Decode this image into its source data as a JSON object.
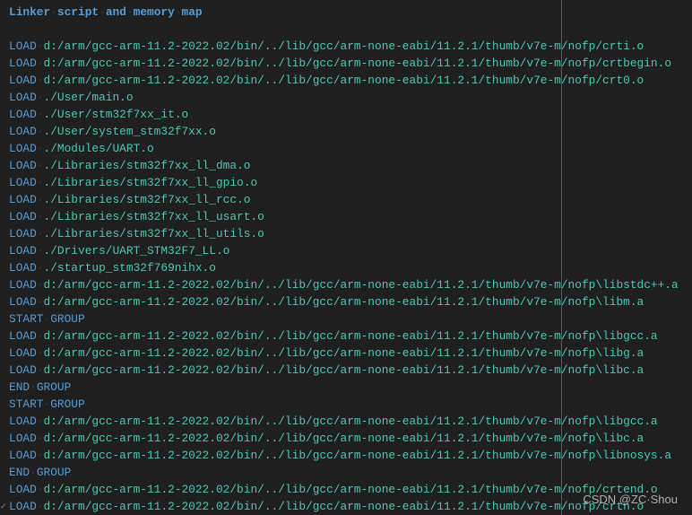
{
  "editor": {
    "whitespace_glyph": "·",
    "colors": {
      "background": "#1f1f1f",
      "keyword": "#569cd6",
      "path": "#4ec9b0",
      "whitespace": "#3e3e3e",
      "ruler": "#5a5a5a"
    },
    "lines": [
      {
        "type": "title",
        "words": [
          "Linker",
          "script",
          "and",
          "memory",
          "map"
        ]
      },
      {
        "type": "blank"
      },
      {
        "type": "cmd",
        "keyword": [
          "LOAD"
        ],
        "path": "d:/arm/gcc-arm-11.2-2022.02/bin/../lib/gcc/arm-none-eabi/11.2.1/thumb/v7e-m/nofp/crti.o"
      },
      {
        "type": "cmd",
        "keyword": [
          "LOAD"
        ],
        "path": "d:/arm/gcc-arm-11.2-2022.02/bin/../lib/gcc/arm-none-eabi/11.2.1/thumb/v7e-m/nofp/crtbegin.o"
      },
      {
        "type": "cmd",
        "keyword": [
          "LOAD"
        ],
        "path": "d:/arm/gcc-arm-11.2-2022.02/bin/../lib/gcc/arm-none-eabi/11.2.1/thumb/v7e-m/nofp/crt0.o"
      },
      {
        "type": "cmd",
        "keyword": [
          "LOAD"
        ],
        "path": "./User/main.o"
      },
      {
        "type": "cmd",
        "keyword": [
          "LOAD"
        ],
        "path": "./User/stm32f7xx_it.o"
      },
      {
        "type": "cmd",
        "keyword": [
          "LOAD"
        ],
        "path": "./User/system_stm32f7xx.o"
      },
      {
        "type": "cmd",
        "keyword": [
          "LOAD"
        ],
        "path": "./Modules/UART.o"
      },
      {
        "type": "cmd",
        "keyword": [
          "LOAD"
        ],
        "path": "./Libraries/stm32f7xx_ll_dma.o"
      },
      {
        "type": "cmd",
        "keyword": [
          "LOAD"
        ],
        "path": "./Libraries/stm32f7xx_ll_gpio.o"
      },
      {
        "type": "cmd",
        "keyword": [
          "LOAD"
        ],
        "path": "./Libraries/stm32f7xx_ll_rcc.o"
      },
      {
        "type": "cmd",
        "keyword": [
          "LOAD"
        ],
        "path": "./Libraries/stm32f7xx_ll_usart.o"
      },
      {
        "type": "cmd",
        "keyword": [
          "LOAD"
        ],
        "path": "./Libraries/stm32f7xx_ll_utils.o"
      },
      {
        "type": "cmd",
        "keyword": [
          "LOAD"
        ],
        "path": "./Drivers/UART_STM32F7_LL.o"
      },
      {
        "type": "cmd",
        "keyword": [
          "LOAD"
        ],
        "path": "./startup_stm32f769nihx.o"
      },
      {
        "type": "cmd",
        "keyword": [
          "LOAD"
        ],
        "path": "d:/arm/gcc-arm-11.2-2022.02/bin/../lib/gcc/arm-none-eabi/11.2.1/thumb/v7e-m/nofp\\libstdc++.a"
      },
      {
        "type": "cmd",
        "keyword": [
          "LOAD"
        ],
        "path": "d:/arm/gcc-arm-11.2-2022.02/bin/../lib/gcc/arm-none-eabi/11.2.1/thumb/v7e-m/nofp\\libm.a"
      },
      {
        "type": "cmd",
        "keyword": [
          "START",
          "GROUP"
        ]
      },
      {
        "type": "cmd",
        "keyword": [
          "LOAD"
        ],
        "path": "d:/arm/gcc-arm-11.2-2022.02/bin/../lib/gcc/arm-none-eabi/11.2.1/thumb/v7e-m/nofp\\libgcc.a"
      },
      {
        "type": "cmd",
        "keyword": [
          "LOAD"
        ],
        "path": "d:/arm/gcc-arm-11.2-2022.02/bin/../lib/gcc/arm-none-eabi/11.2.1/thumb/v7e-m/nofp\\libg.a"
      },
      {
        "type": "cmd",
        "keyword": [
          "LOAD"
        ],
        "path": "d:/arm/gcc-arm-11.2-2022.02/bin/../lib/gcc/arm-none-eabi/11.2.1/thumb/v7e-m/nofp\\libc.a"
      },
      {
        "type": "cmd",
        "keyword": [
          "END",
          "GROUP"
        ]
      },
      {
        "type": "cmd",
        "keyword": [
          "START",
          "GROUP"
        ]
      },
      {
        "type": "cmd",
        "keyword": [
          "LOAD"
        ],
        "path": "d:/arm/gcc-arm-11.2-2022.02/bin/../lib/gcc/arm-none-eabi/11.2.1/thumb/v7e-m/nofp\\libgcc.a"
      },
      {
        "type": "cmd",
        "keyword": [
          "LOAD"
        ],
        "path": "d:/arm/gcc-arm-11.2-2022.02/bin/../lib/gcc/arm-none-eabi/11.2.1/thumb/v7e-m/nofp\\libc.a"
      },
      {
        "type": "cmd",
        "keyword": [
          "LOAD"
        ],
        "path": "d:/arm/gcc-arm-11.2-2022.02/bin/../lib/gcc/arm-none-eabi/11.2.1/thumb/v7e-m/nofp\\libnosys.a"
      },
      {
        "type": "cmd",
        "keyword": [
          "END",
          "GROUP"
        ]
      },
      {
        "type": "cmd",
        "keyword": [
          "LOAD"
        ],
        "path": "d:/arm/gcc-arm-11.2-2022.02/bin/../lib/gcc/arm-none-eabi/11.2.1/thumb/v7e-m/nofp/crtend.o"
      },
      {
        "type": "cmd",
        "keyword": [
          "LOAD"
        ],
        "path": "d:/arm/gcc-arm-11.2-2022.02/bin/../lib/gcc/arm-none-eabi/11.2.1/thumb/v7e-m/nofp/crtn.o"
      }
    ],
    "fold_glyph": "✓"
  },
  "watermark": "CSDN @ZC·Shou"
}
